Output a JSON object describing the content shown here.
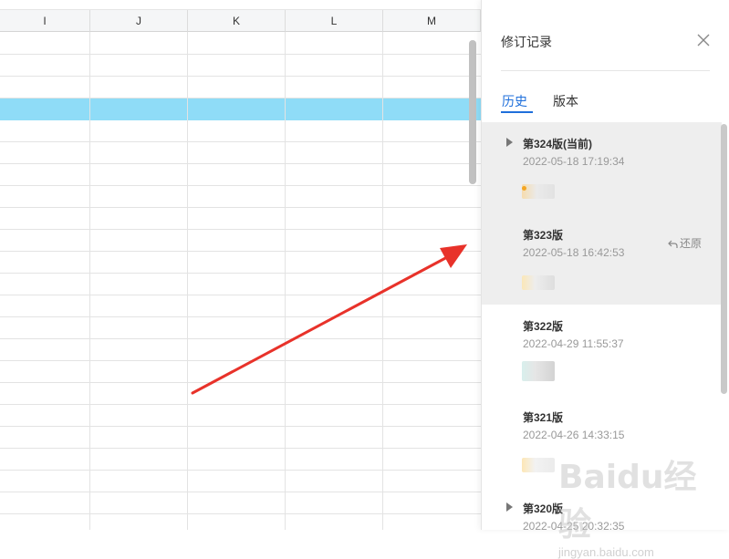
{
  "sheet": {
    "columns": [
      "I",
      "J",
      "K",
      "L",
      "M"
    ]
  },
  "panel": {
    "title": "修订记录",
    "close_icon": "close-icon",
    "tabs": [
      {
        "label": "历史",
        "active": true
      },
      {
        "label": "版本",
        "active": false
      }
    ],
    "restore_label": "还原",
    "versions": [
      {
        "title": "第324版(当前)",
        "time": "2022-05-18 17:19:34",
        "expandable": true,
        "highlighted": true
      },
      {
        "title": "第323版",
        "time": "2022-05-18 16:42:53",
        "expandable": false,
        "highlighted": true,
        "restore": true
      },
      {
        "title": "第322版",
        "time": "2022-04-29 11:55:37",
        "expandable": false,
        "highlighted": false
      },
      {
        "title": "第321版",
        "time": "2022-04-26 14:33:15",
        "expandable": false,
        "highlighted": false
      },
      {
        "title": "第320版",
        "time": "2022-04-25 20:32:35",
        "expandable": true,
        "highlighted": false
      }
    ]
  },
  "annotation": {
    "arrow_color": "#e8322a"
  },
  "colors": {
    "accent": "#1f6fdb",
    "selected_row": "#8fdcf7"
  },
  "watermark": {
    "text": "Baidu经验",
    "sub": "jingyan.baidu.com"
  }
}
